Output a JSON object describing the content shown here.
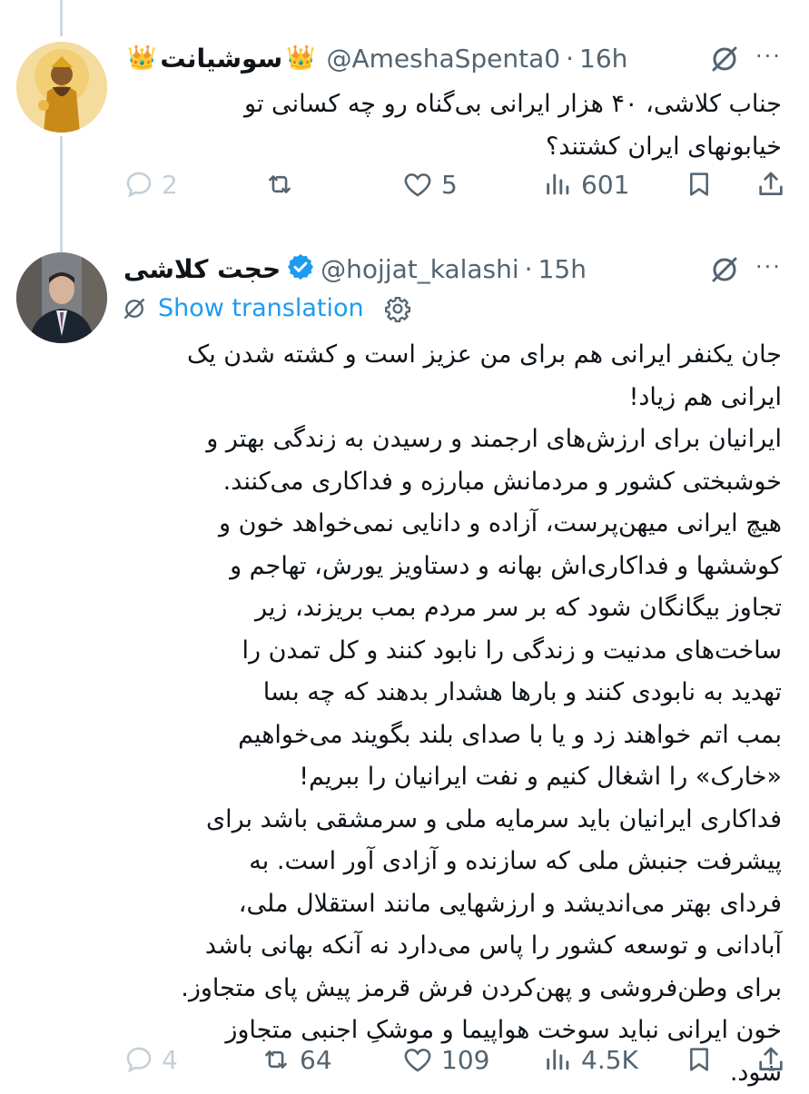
{
  "tweet1": {
    "name": "سوشیانت",
    "handle": "@AmeshaSpenta0",
    "separator": "·",
    "time": "16h",
    "text": "جناب کلاشی، ۴۰ هزار ایرانی بی‌گناه رو چه کسانی تو\nخیابونهای ایران کشتند؟",
    "replies": "2",
    "retweets": "",
    "likes": "5",
    "views": "601"
  },
  "tweet2": {
    "name": "حجت کلاشی",
    "handle": "@hojjat_kalashi",
    "separator": "·",
    "time": "15h",
    "show_translation": "Show translation",
    "text": "جان یکنفر ایرانی هم برای من عزیز است و کشته شدن یک\nایرانی هم زیاد!\nایرانیان برای ارزش‌های ارجمند و رسیدن به زندگی بهتر و\nخوشبختی کشور و مردمانش مبارزه و فداکاری می‌کنند.\nهیچ ایرانی میهن‌پرست، آزاده و دانایی نمی‌خواهد خون و\nکوششها و فداکاری‌اش بهانه و دستاویز یورش، تهاجم و\nتجاوز بیگانگان شود که بر سر مردم بمب بریزند، زیر\nساخت‌های مدنیت و زندگی را نابود کنند و کل تمدن را\nتهدید به نابودی کنند و بارها هشدار بدهند که چه بسا\nبمب اتم خواهند زد و یا با صدای بلند بگویند می‌خواهیم\n«خارک» را اشغال کنیم و نفت ایرانیان را ببریم!\nفداکاری ایرانیان باید سرمایه ملی و سرمشقی باشد برای\nپیشرفت جنبش ملی که سازنده و آزادی آور است. به\nفردای بهتر می‌اندیشد و ارزشهایی مانند استقلال ملی،\nآبادانی و توسعه کشور را پاس می‌دارد نه آنکه بهانی باشد\nبرای وطن‌فروشی و پهن‌کردن فرش قرمز پیش پای متجاوز.\nخون ایرانی نباید سوخت هواپیما و موشکِ اجنبی متجاوز\nشود.",
    "replies": "4",
    "retweets": "64",
    "likes": "109",
    "views": "4.5K"
  },
  "icons": {
    "reply": "reply-icon",
    "retweet": "retweet-icon",
    "like": "heart-icon",
    "views": "views-icon",
    "bookmark": "bookmark-icon",
    "share": "share-icon",
    "more": "more-icon",
    "grok": "grok-icon",
    "verified": "verified-badge-icon",
    "crown": "crown-icon",
    "translate": "translate-icon",
    "settings": "gear-icon"
  },
  "colors": {
    "accent": "#1d9bf0",
    "muted": "#536471",
    "text": "#0f1419",
    "thread_line": "#cfd9de"
  }
}
